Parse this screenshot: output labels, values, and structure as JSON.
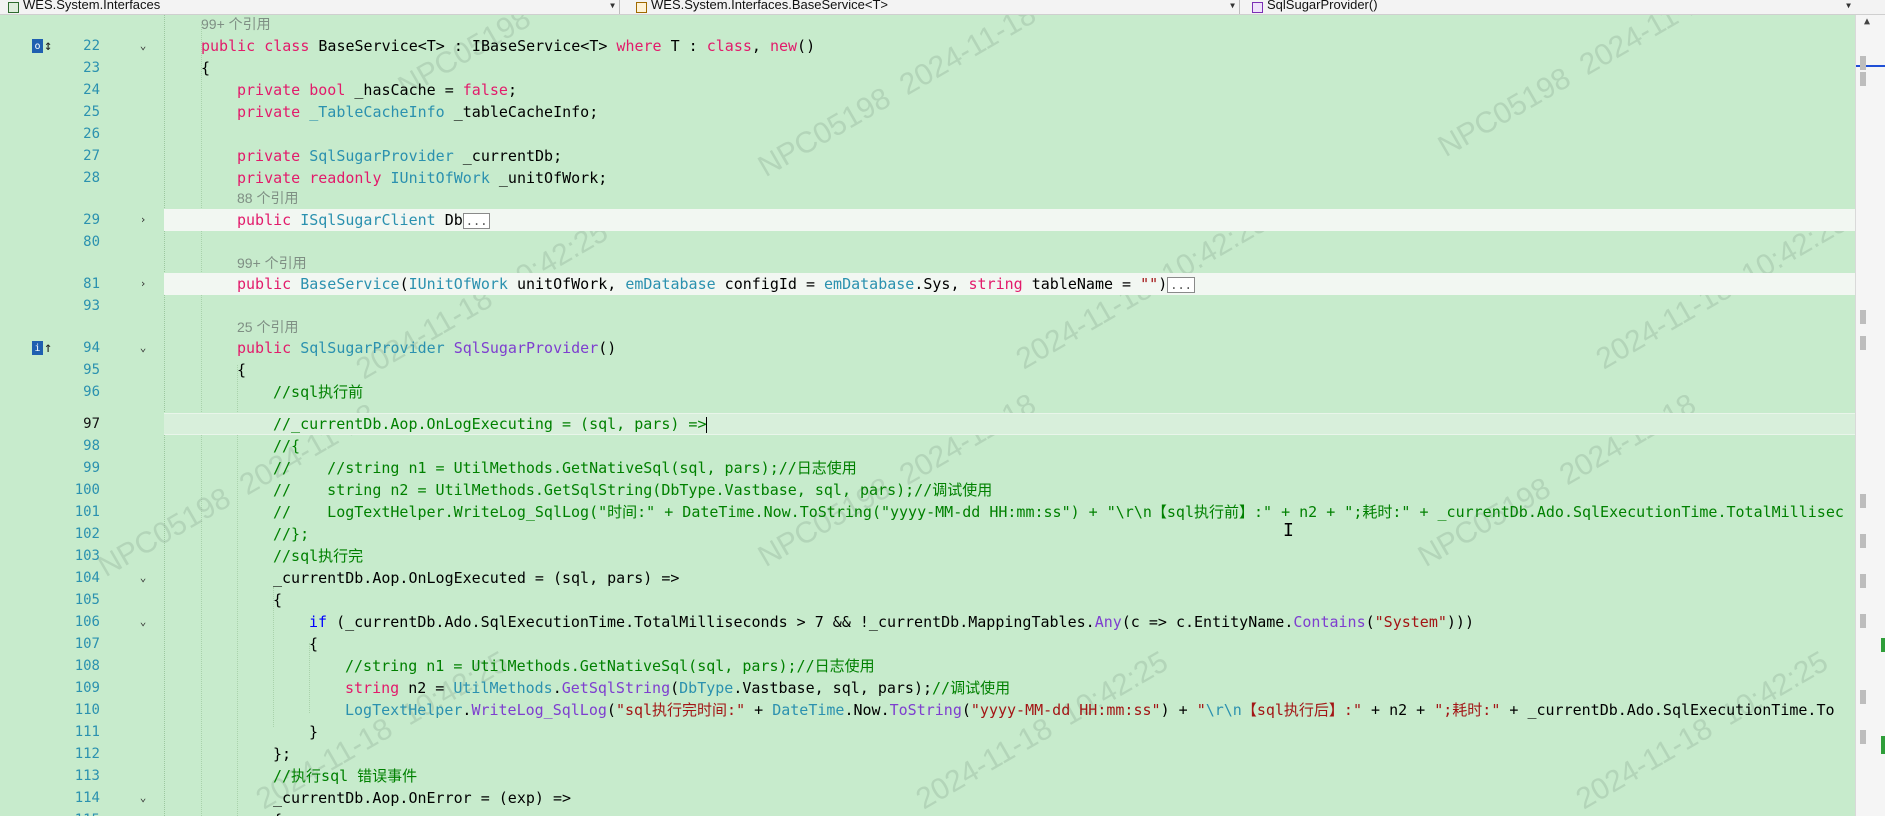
{
  "navbar": {
    "project": "WES.System.Interfaces",
    "type": "WES.System.Interfaces.BaseService<T>",
    "member": "SqlSugarProvider()"
  },
  "refs": {
    "r1": "99+ 个引用",
    "r2": "88 个引用",
    "r3": "99+ 个引用",
    "r4": "25 个引用"
  },
  "line_numbers": {
    "l22": "22",
    "l23": "23",
    "l24": "24",
    "l25": "25",
    "l26": "26",
    "l27": "27",
    "l28": "28",
    "l29": "29",
    "l80": "80",
    "l81": "81",
    "l93": "93",
    "l94": "94",
    "l95": "95",
    "l96": "96",
    "l97": "97",
    "l98": "98",
    "l99": "99",
    "l100": "100",
    "l101": "101",
    "l102": "102",
    "l103": "103",
    "l104": "104",
    "l105": "105",
    "l106": "106",
    "l107": "107",
    "l108": "108",
    "l109": "109",
    "l110": "110",
    "l111": "111",
    "l112": "112",
    "l113": "113",
    "l114": "114",
    "l115": "115"
  },
  "code": {
    "c22": {
      "a": "public",
      "b": " ",
      "c": "class",
      "d": " BaseService<T> : IBaseService<T> ",
      "e": "where",
      "f": " T : ",
      "g": "class",
      "h": ", ",
      "i": "new",
      "j": "()"
    },
    "c23": "{",
    "c24": {
      "a": "private",
      "b": " ",
      "c": "bool",
      "d": " _hasCache = ",
      "e": "false",
      "f": ";"
    },
    "c25": {
      "a": "private",
      "b": " ",
      "c": "_TableCacheInfo",
      "d": " _tableCacheInfo;"
    },
    "c27": {
      "a": "private",
      "b": " ",
      "c": "SqlSugarProvider",
      "d": " _currentDb;"
    },
    "c28": {
      "a": "private",
      "b": " ",
      "c": "readonly",
      "d": " ",
      "e": "IUnitOfWork",
      "f": " _unitOfWork;"
    },
    "c29": {
      "a": "public",
      "b": " ",
      "c": "ISqlSugarClient",
      "d": " Db",
      "e": "..."
    },
    "c81": {
      "a": "public",
      "b": " ",
      "c": "BaseService",
      "d": "(",
      "e": "IUnitOfWork",
      "f": " unitOfWork, ",
      "g": "emDatabase",
      "h": " configId = ",
      "i": "emDatabase",
      "j": ".Sys, ",
      "k": "string",
      "l": " tableName = ",
      "m": "\"\"",
      "n": ")",
      "o": "..."
    },
    "c94": {
      "a": "public",
      "b": " ",
      "c": "SqlSugarProvider",
      "d": " ",
      "e": "SqlSugarProvider",
      "f": "()"
    },
    "c95": "{",
    "c96": "//sql执行前",
    "c97": "//_currentDb.Aop.OnLogExecuting = (sql, pars) =>",
    "c98": "//{",
    "c99": "//    //string n1 = UtilMethods.GetNativeSql(sql, pars);//日志使用",
    "c100": "//    string n2 = UtilMethods.GetSqlString(DbType.Vastbase, sql, pars);//调试使用",
    "c101": "//    LogTextHelper.WriteLog_SqlLog(\"时间:\" + DateTime.Now.ToString(\"yyyy-MM-dd HH:mm:ss\") + \"\\r\\n【sql执行前】:\" + n2 + \";耗时:\" + _currentDb.Ado.SqlExecutionTime.TotalMillisec",
    "c102": "//};",
    "c103": "//sql执行完",
    "c104": "_currentDb.Aop.OnLogExecuted = (sql, pars) =>",
    "c105": "{",
    "c106": {
      "a": "if",
      "b": " (_currentDb.Ado.SqlExecutionTime.TotalMilliseconds > 7 && !_currentDb.MappingTables.",
      "c": "Any",
      "d": "(c => c.EntityName.",
      "e": "Contains",
      "f": "(",
      "g": "\"System\"",
      "h": ")))"
    },
    "c107": "{",
    "c108": "//string n1 = UtilMethods.GetNativeSql(sql, pars);//日志使用",
    "c109": {
      "a": "string",
      "b": " n2 = ",
      "c": "UtilMethods",
      "d": ".",
      "e": "GetSqlString",
      "f": "(",
      "g": "DbType",
      "h": ".Vastbase, sql, pars);",
      "i": "//调试使用"
    },
    "c110": {
      "a": "LogTextHelper",
      "b": ".",
      "c": "WriteLog_SqlLog",
      "d": "(",
      "e": "\"sql执行完时间:\"",
      "f": " + ",
      "g": "DateTime",
      "h": ".Now.",
      "i": "ToString",
      "j": "(",
      "k": "\"yyyy-MM-dd HH:mm:ss\"",
      "l": ") + ",
      "m": "\"",
      "n": "\\r\\n",
      "o": "【sql执行后】:\"",
      "p": " + n2 + ",
      "q": "\";耗时:\"",
      "r": " + _currentDb.Ado.SqlExecutionTime.To"
    },
    "c111": "}",
    "c112": "};",
    "c113": "//执行sql 错误事件",
    "c114": "_currentDb.Aop.OnError = (exp) =>",
    "c115": "{"
  },
  "watermark": {
    "text1": "NPC05198",
    "text2": "2024-11-18",
    "text3": "10:42:25"
  },
  "colors": {
    "background": "#c7ebcc",
    "keyword": "#e21b6b",
    "type": "#2b91af",
    "comment": "#008000",
    "string": "#a31515"
  }
}
